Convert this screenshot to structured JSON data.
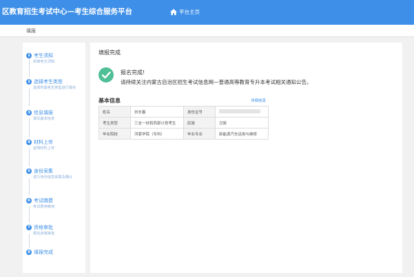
{
  "header": {
    "title": "区教育招生考试中心—考生综合服务平台",
    "nav_home": "平台主页"
  },
  "breadcrumb": "填报",
  "steps": [
    {
      "num": "1",
      "label": "考生须知",
      "desc": "阅读考生须知"
    },
    {
      "num": "2",
      "label": "选择考生类型",
      "desc": "选择所属考生类型进行报名"
    },
    {
      "num": "3",
      "label": "信息填报",
      "desc": "填写基本信息"
    },
    {
      "num": "4",
      "label": "材料上传",
      "desc": "证明材料上传"
    },
    {
      "num": "5",
      "label": "身份采集",
      "desc": "进行身份信息采集及确认"
    },
    {
      "num": "6",
      "label": "考试缴费",
      "desc": "考试费用缴纳"
    },
    {
      "num": "7",
      "label": "资格审批",
      "desc": "报名资格审批"
    },
    {
      "num": "8",
      "label": "填报完成",
      "desc": ""
    }
  ],
  "main": {
    "title": "填报完成",
    "success_title": "报名完成!",
    "success_msg": "请持续关注内蒙古自治区招生考试信息网—普通高等教育专升本考试相关通知公告。",
    "info_title": "基本信息",
    "detail_link": "详细信息"
  },
  "info": {
    "name_label": "姓名",
    "name_value": "刘长春",
    "id_label": "身份证号",
    "type_label": "考生类型",
    "type_value": "三支一扶和西部计划考生",
    "ethnic_label": "民族",
    "ethnic_value": "汉族",
    "school_label": "毕业院校",
    "school_value": "河套学院（专科）",
    "major_label": "毕业专业",
    "major_value": "新能源汽车运用与维修"
  },
  "colors": {
    "primary": "#3d8fe8",
    "success": "#4fbf96"
  }
}
